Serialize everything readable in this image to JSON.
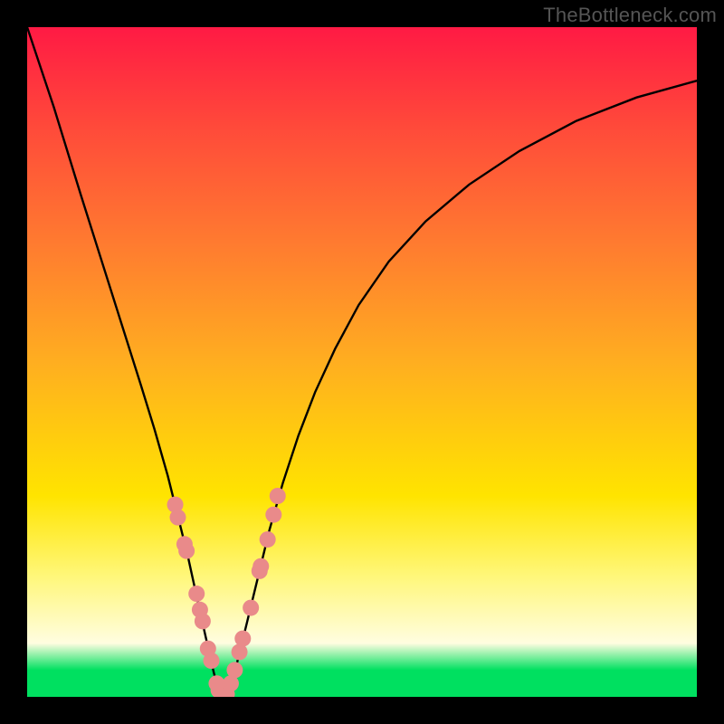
{
  "watermark": "TheBottleneck.com",
  "chart_data": {
    "type": "line",
    "title": "",
    "xlabel": "",
    "ylabel": "",
    "xlim": [
      0,
      1
    ],
    "ylim": [
      0,
      1
    ],
    "series": [
      {
        "name": "bottleneck-curve",
        "x": [
          0.0,
          0.04,
          0.08,
          0.11,
          0.14,
          0.17,
          0.19,
          0.21,
          0.225,
          0.24,
          0.252,
          0.262,
          0.271,
          0.279,
          0.286,
          0.293,
          0.3,
          0.312,
          0.328,
          0.345,
          0.362,
          0.382,
          0.405,
          0.43,
          0.46,
          0.495,
          0.54,
          0.595,
          0.66,
          0.735,
          0.82,
          0.91,
          1.0
        ],
        "y": [
          1.0,
          0.88,
          0.75,
          0.655,
          0.56,
          0.465,
          0.4,
          0.33,
          0.27,
          0.21,
          0.155,
          0.11,
          0.07,
          0.035,
          0.01,
          0.0,
          0.01,
          0.045,
          0.11,
          0.18,
          0.25,
          0.32,
          0.39,
          0.455,
          0.52,
          0.585,
          0.65,
          0.71,
          0.765,
          0.815,
          0.86,
          0.895,
          0.92
        ]
      }
    ],
    "scatter": [
      {
        "name": "highlight-points",
        "color": "#e98a8a",
        "x": [
          0.221,
          0.225,
          0.235,
          0.238,
          0.253,
          0.258,
          0.262,
          0.27,
          0.275,
          0.283,
          0.286,
          0.293,
          0.298,
          0.304,
          0.31,
          0.317,
          0.322,
          0.334,
          0.347,
          0.349,
          0.359,
          0.368,
          0.374
        ],
        "y": [
          0.287,
          0.268,
          0.228,
          0.218,
          0.154,
          0.13,
          0.113,
          0.072,
          0.054,
          0.02,
          0.01,
          0.0,
          0.004,
          0.02,
          0.04,
          0.067,
          0.087,
          0.133,
          0.188,
          0.195,
          0.235,
          0.272,
          0.3
        ]
      }
    ],
    "background": {
      "gradient_stops": [
        {
          "pos": 0.0,
          "color": "#ff1a44"
        },
        {
          "pos": 0.5,
          "color": "#ffae20"
        },
        {
          "pos": 0.82,
          "color": "#fff77a"
        },
        {
          "pos": 0.96,
          "color": "#00e060"
        }
      ]
    }
  }
}
